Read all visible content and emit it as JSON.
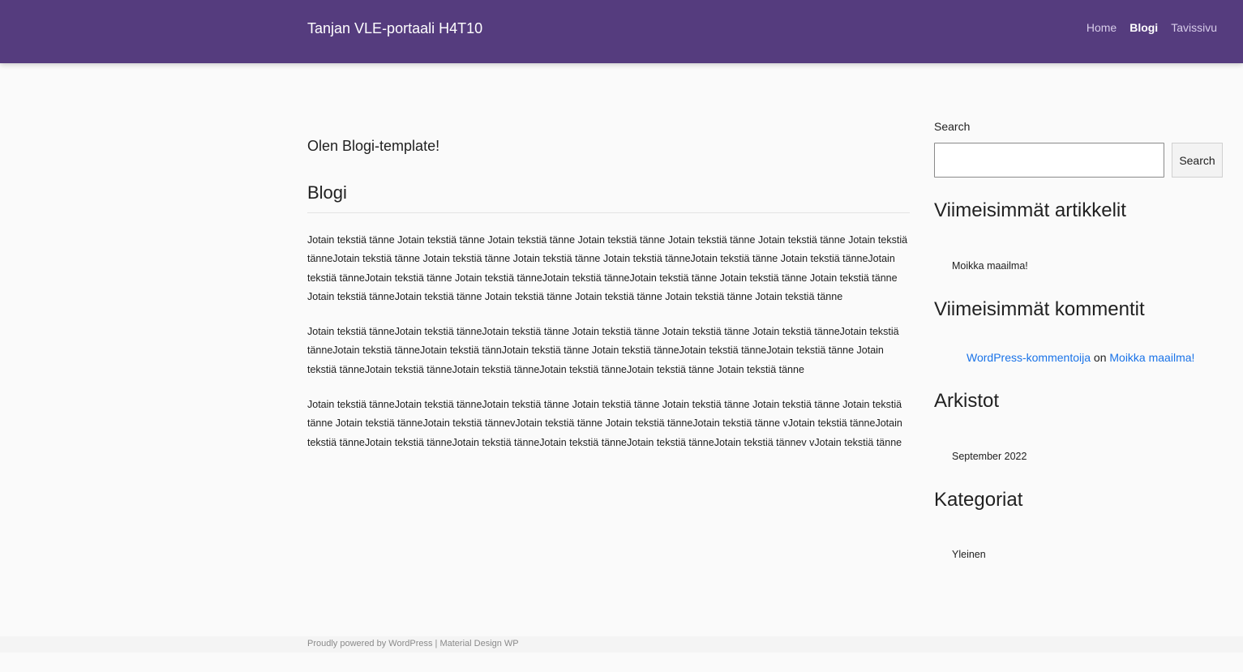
{
  "header": {
    "site_title": "Tanjan VLE-portaali H4T10",
    "nav": [
      "Home",
      "Blogi",
      "Tavissivu"
    ]
  },
  "main": {
    "intro": "Olen Blogi-template!",
    "section_title": "Blogi",
    "paragraphs": [
      "Jotain tekstiä tänne Jotain tekstiä tänne Jotain tekstiä tänne Jotain tekstiä tänne Jotain tekstiä tänne Jotain tekstiä tänne Jotain tekstiä tänneJotain tekstiä tänne Jotain tekstiä tänne Jotain tekstiä tänne Jotain tekstiä tänneJotain tekstiä tänne Jotain tekstiä tänneJotain tekstiä tänneJotain tekstiä tänne Jotain tekstiä tänneJotain tekstiä tänneJotain tekstiä tänne Jotain tekstiä tänne Jotain tekstiä tänne Jotain tekstiä tänneJotain tekstiä tänne Jotain tekstiä tänne Jotain tekstiä tänne Jotain tekstiä tänne Jotain tekstiä tänne",
      "Jotain tekstiä tänneJotain tekstiä tänneJotain tekstiä tänne Jotain tekstiä tänne Jotain tekstiä tänne Jotain tekstiä tänneJotain tekstiä tänneJotain tekstiä tänneJotain tekstiä tännJotain tekstiä tänne Jotain tekstiä tänneJotain tekstiä tänneJotain tekstiä tänne Jotain tekstiä tänneJotain tekstiä tänneJotain tekstiä tänneJotain tekstiä tänneJotain tekstiä tänne Jotain tekstiä tänne",
      "Jotain tekstiä tänneJotain tekstiä tänneJotain tekstiä tänne Jotain tekstiä tänne Jotain tekstiä tänne Jotain tekstiä tänne Jotain tekstiä tänne Jotain tekstiä tänneJotain tekstiä tännevJotain tekstiä tänne Jotain tekstiä tänneJotain tekstiä tänne vJotain tekstiä tänneJotain tekstiä tänneJotain tekstiä tänneJotain tekstiä tänneJotain tekstiä tänneJotain tekstiä tänneJotain tekstiä tännev vJotain tekstiä tänne"
    ]
  },
  "sidebar": {
    "search_label": "Search",
    "search_value": "",
    "search_button": "Search",
    "recent_posts_title": "Viimeisimmät artikkelit",
    "recent_posts": [
      "Moikka maailma!"
    ],
    "recent_comments_title": "Viimeisimmät kommentit",
    "comment": {
      "author": "WordPress-kommentoija",
      "on": "on",
      "post": "Moikka maailma!"
    },
    "archives_title": "Arkistot",
    "archives": [
      "September 2022"
    ],
    "categories_title": "Kategoriat",
    "categories": [
      "Yleinen"
    ]
  },
  "footer": {
    "text": "Proudly powered by WordPress | Material Design WP"
  },
  "colors": {
    "header_bg": "#553c7e",
    "link": "#1a73e8",
    "page_bg": "#fafafa"
  }
}
